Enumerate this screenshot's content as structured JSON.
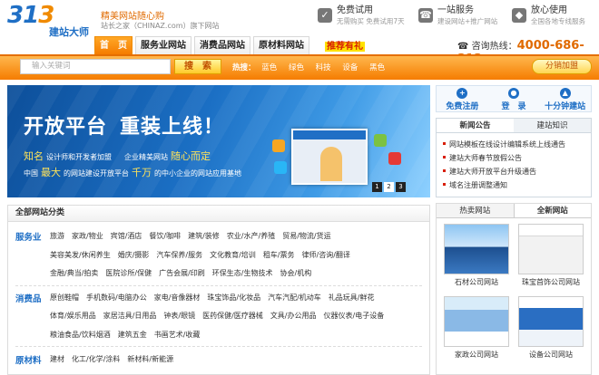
{
  "logo": {
    "main": "313",
    "sub": "建站大师"
  },
  "slogan": {
    "line1": "精美网站随心购",
    "line2": "站长之家（CHINAZ.com）旗下网站"
  },
  "services": [
    {
      "icon": "stamp-icon",
      "title": "免费试用",
      "desc": "无需购买 免费试用7天"
    },
    {
      "icon": "support-icon",
      "title": "一站服务",
      "desc": "建设网站+推广网站"
    },
    {
      "icon": "shield-icon",
      "title": "放心使用",
      "desc": "全国各地专线服务"
    }
  ],
  "nav": {
    "tabs": [
      "首　页",
      "服务业网站",
      "消费品网站",
      "原材料网站"
    ],
    "promo": "推荐有礼"
  },
  "hotline": {
    "label": "咨询热线：",
    "number": "4000-686-313"
  },
  "search": {
    "placeholder": "输入关键词",
    "button": "搜　索",
    "hot_label": "热搜：",
    "hot_words": [
      "蓝色",
      "绿色",
      "科技",
      "设备",
      "黑色"
    ],
    "fav": "分销加盟"
  },
  "banner": {
    "headline1": "开放平台",
    "headline2": "重装上线！",
    "l1": [
      "知名",
      "设计师和开发者加盟",
      "企业精美网站",
      "随心而定"
    ],
    "l2": [
      "中国",
      "最大",
      "的网站建设开放平台",
      "千万",
      "的中小企业的网站应用基地"
    ],
    "slides": [
      "1",
      "2",
      "3"
    ]
  },
  "quick_actions": [
    "免费注册",
    "登　录",
    "十分钟建站"
  ],
  "news": {
    "tabs": [
      "新闻公告",
      "建站知识"
    ],
    "items": [
      "网站模板在线设计编辑系统上线通告",
      "建站大师春节放假公告",
      "建站大师开放平台升级通告",
      "域名注册调整通知"
    ]
  },
  "categories": {
    "title": "全部网站分类",
    "groups": [
      {
        "name": "服务业",
        "rows": [
          [
            "旅游",
            "家政/物业",
            "宾馆/酒店",
            "餐饮/咖啡",
            "建筑/装修",
            "农业/水产/养殖",
            "贸易/物流/货运"
          ],
          [
            "美容美发/休闲养生",
            "婚庆/摄影",
            "汽车保养/服务",
            "文化教育/培训",
            "租车/票务",
            "律师/咨询/翻译"
          ],
          [
            "金融/典当/拍卖",
            "医院诊所/保健",
            "广告会展/印刷",
            "环保生态/生物技术",
            "协会/机构"
          ]
        ]
      },
      {
        "name": "消费品",
        "rows": [
          [
            "原创鞋帽",
            "手机数码/电脑办公",
            "家电/音像器材",
            "珠宝饰品/化妆品",
            "汽车汽配/机动车",
            "礼品玩具/鲜花"
          ],
          [
            "体育/娱乐用品",
            "家居洁具/日用品",
            "钟表/眼镜",
            "医药保健/医疗器械",
            "文具/办公用品",
            "仪器仪表/电子设备"
          ],
          [
            "粮油食品/饮料烟酒",
            "建筑五金",
            "书画艺术/收藏"
          ]
        ]
      },
      {
        "name": "原材料",
        "rows": [
          [
            "建材",
            "化工/化学/涂料",
            "新材料/新能源"
          ]
        ]
      }
    ]
  },
  "sites": {
    "tabs": [
      "热卖网站",
      "全新网站"
    ],
    "items": [
      "石材公司网站",
      "珠宝首饰公司网站",
      "家政公司网站",
      "设备公司网站"
    ]
  }
}
